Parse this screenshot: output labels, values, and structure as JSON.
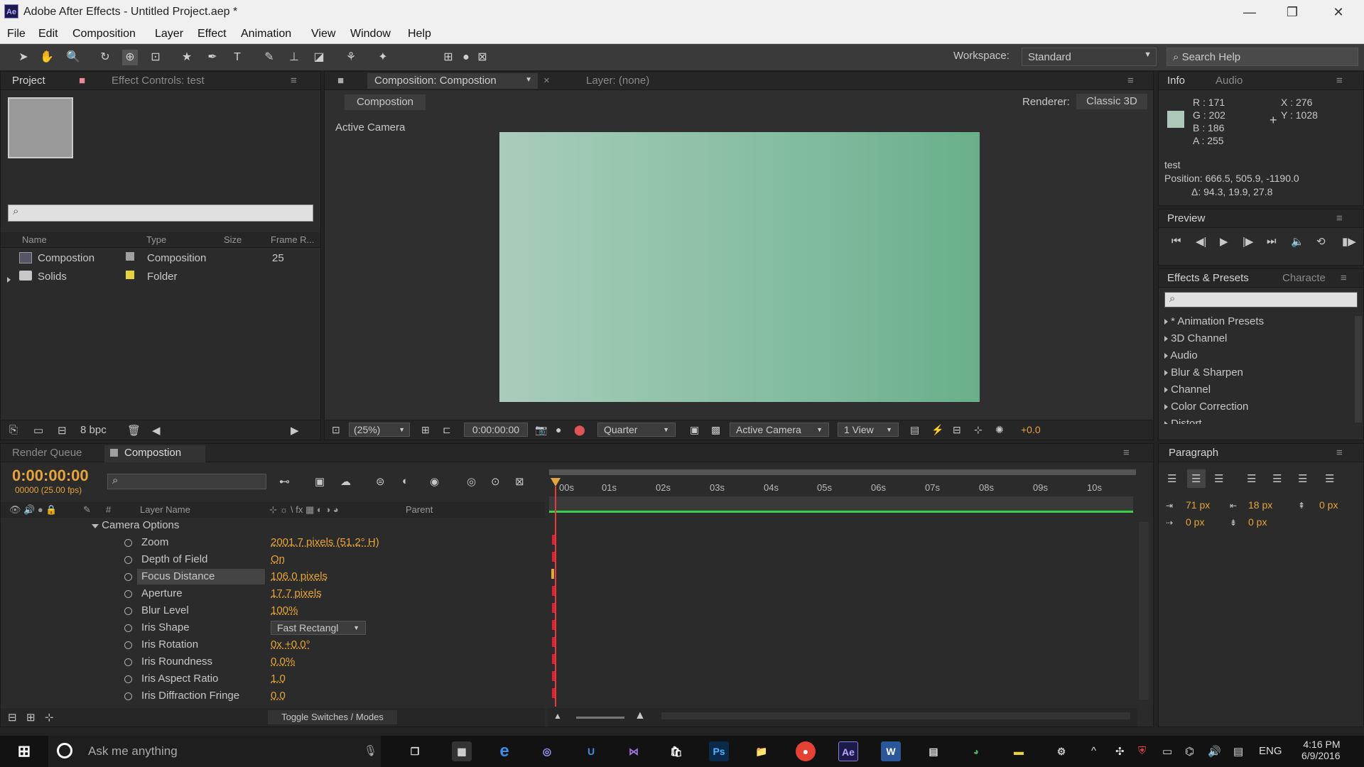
{
  "app": {
    "title": "Adobe After Effects - Untitled Project.aep *",
    "logo": "Ae"
  },
  "menu": [
    "File",
    "Edit",
    "Composition",
    "Layer",
    "Effect",
    "Animation",
    "View",
    "Window",
    "Help"
  ],
  "toolbar": {
    "workspace_label": "Workspace:",
    "workspace_value": "Standard",
    "search_placeholder": "Search Help"
  },
  "project": {
    "tab": "Project",
    "tab2": "Effect Controls: test",
    "columns": [
      "Name",
      "Type",
      "Size",
      "Frame R..."
    ],
    "items": [
      {
        "name": "Compostion",
        "type": "Composition",
        "frame": "25",
        "color": "#a0a0a0"
      },
      {
        "name": "Solids",
        "type": "Folder",
        "frame": "",
        "color": "#e6d33b"
      }
    ],
    "bpc": "8 bpc"
  },
  "composition": {
    "tab": "Composition: Compostion",
    "layer_tab": "Layer: (none)",
    "sub_tab": "Compostion",
    "renderer_label": "Renderer:",
    "renderer_value": "Classic 3D",
    "camera_label": "Active Camera",
    "zoom": "(25%)",
    "timecode": "0:00:00:00",
    "resolution": "Quarter",
    "view": "Active Camera",
    "views": "1 View",
    "exposure": "+0.0"
  },
  "info": {
    "tab": "Info",
    "tab2": "Audio",
    "r": "R : 171",
    "g": "G : 202",
    "b": "B : 186",
    "a": "A : 255",
    "x": "X : 276",
    "y": "Y : 1028",
    "swatch": "#abcaba",
    "layer": "test",
    "position": "Position: 666.5, 505.9, -1190.0",
    "delta": "Δ: 94.3, 19.9, 27.8"
  },
  "preview": {
    "tab": "Preview"
  },
  "effects": {
    "tab": "Effects & Presets",
    "tab2": "Characte",
    "items": [
      "* Animation Presets",
      "3D Channel",
      "Audio",
      "Blur & Sharpen",
      "Channel",
      "Color Correction",
      "Distort"
    ]
  },
  "paragraph": {
    "tab": "Paragraph",
    "indent_left": "71 px",
    "indent_right": "18 px",
    "space_before": "0 px",
    "first_line": "0 px",
    "space_after": "0 px"
  },
  "timeline": {
    "tab1": "Render Queue",
    "tab2": "Compostion",
    "timecode": "0:00:00:00",
    "fps": "00000 (25.00 fps)",
    "layer_name_col": "Layer Name",
    "parent_col": "Parent",
    "group": "Camera Options",
    "props": [
      {
        "name": "Zoom",
        "value": "2001.7 pixels (51.2° H)"
      },
      {
        "name": "Depth of Field",
        "value": "On"
      },
      {
        "name": "Focus Distance",
        "value": "106.0 pixels"
      },
      {
        "name": "Aperture",
        "value": "17.7 pixels"
      },
      {
        "name": "Blur Level",
        "value": "100%"
      },
      {
        "name": "Iris Shape",
        "value": "Fast Rectangl"
      },
      {
        "name": "Iris Rotation",
        "value": "0x +0.0°"
      },
      {
        "name": "Iris Roundness",
        "value": "0.0%"
      },
      {
        "name": "Iris Aspect Ratio",
        "value": "1.0"
      },
      {
        "name": "Iris Diffraction Fringe",
        "value": "0.0"
      }
    ],
    "ruler": [
      "00s",
      "01s",
      "02s",
      "03s",
      "04s",
      "05s",
      "06s",
      "07s",
      "08s",
      "09s",
      "10s"
    ],
    "toggle": "Toggle Switches / Modes"
  },
  "taskbar": {
    "search": "Ask me anything",
    "lang": "ENG",
    "time": "4:16 PM",
    "date": "6/9/2016"
  }
}
